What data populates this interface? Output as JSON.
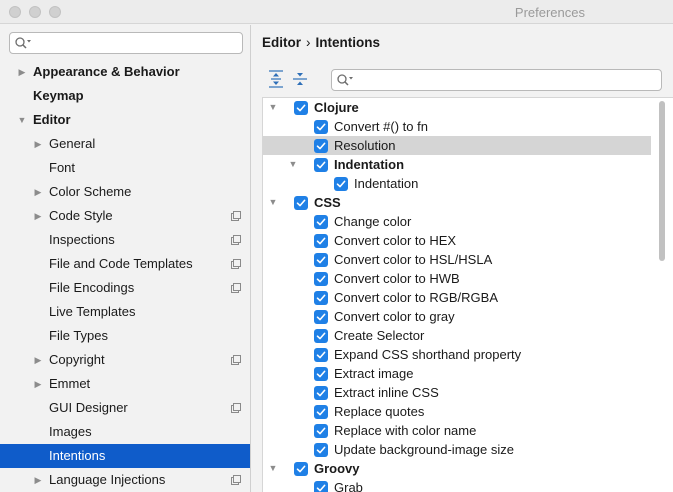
{
  "window": {
    "title": "Preferences"
  },
  "sidebar": {
    "search_placeholder": "",
    "items": [
      {
        "label": "Appearance & Behavior",
        "level": 0,
        "arrow": "right",
        "bold": true,
        "project": false
      },
      {
        "label": "Keymap",
        "level": 0,
        "arrow": "none",
        "bold": true,
        "project": false
      },
      {
        "label": "Editor",
        "level": 0,
        "arrow": "down",
        "bold": true,
        "project": false
      },
      {
        "label": "General",
        "level": 1,
        "arrow": "right",
        "bold": false,
        "project": false
      },
      {
        "label": "Font",
        "level": 1,
        "arrow": "none",
        "bold": false,
        "project": false
      },
      {
        "label": "Color Scheme",
        "level": 1,
        "arrow": "right",
        "bold": false,
        "project": false
      },
      {
        "label": "Code Style",
        "level": 1,
        "arrow": "right",
        "bold": false,
        "project": true
      },
      {
        "label": "Inspections",
        "level": 1,
        "arrow": "none",
        "bold": false,
        "project": true
      },
      {
        "label": "File and Code Templates",
        "level": 1,
        "arrow": "none",
        "bold": false,
        "project": true
      },
      {
        "label": "File Encodings",
        "level": 1,
        "arrow": "none",
        "bold": false,
        "project": true
      },
      {
        "label": "Live Templates",
        "level": 1,
        "arrow": "none",
        "bold": false,
        "project": false
      },
      {
        "label": "File Types",
        "level": 1,
        "arrow": "none",
        "bold": false,
        "project": false
      },
      {
        "label": "Copyright",
        "level": 1,
        "arrow": "right",
        "bold": false,
        "project": true
      },
      {
        "label": "Emmet",
        "level": 1,
        "arrow": "right",
        "bold": false,
        "project": false
      },
      {
        "label": "GUI Designer",
        "level": 1,
        "arrow": "none",
        "bold": false,
        "project": true
      },
      {
        "label": "Images",
        "level": 1,
        "arrow": "none",
        "bold": false,
        "project": false
      },
      {
        "label": "Intentions",
        "level": 1,
        "arrow": "none",
        "bold": false,
        "project": false,
        "selected": true
      },
      {
        "label": "Language Injections",
        "level": 1,
        "arrow": "right",
        "bold": false,
        "project": true
      }
    ]
  },
  "header": {
    "crumb_parent": "Editor",
    "crumb_separator": "›",
    "crumb_current": "Intentions"
  },
  "intentions_search_placeholder": "",
  "tree": [
    {
      "label": "Clojure",
      "level": 0,
      "group": true,
      "arrow": "down",
      "checked": true
    },
    {
      "label": "Convert #() to fn",
      "level": 1,
      "group": false,
      "arrow": "none",
      "checked": true
    },
    {
      "label": "Resolution",
      "level": 1,
      "group": false,
      "arrow": "none",
      "checked": true,
      "highlight": true
    },
    {
      "label": "Indentation",
      "level": 1,
      "group": true,
      "arrow": "down",
      "checked": true
    },
    {
      "label": "Indentation",
      "level": 2,
      "group": false,
      "arrow": "none",
      "checked": true
    },
    {
      "label": "CSS",
      "level": 0,
      "group": true,
      "arrow": "down",
      "checked": true
    },
    {
      "label": "Change color",
      "level": 1,
      "group": false,
      "arrow": "none",
      "checked": true
    },
    {
      "label": "Convert color to HEX",
      "level": 1,
      "group": false,
      "arrow": "none",
      "checked": true
    },
    {
      "label": "Convert color to HSL/HSLA",
      "level": 1,
      "group": false,
      "arrow": "none",
      "checked": true
    },
    {
      "label": "Convert color to HWB",
      "level": 1,
      "group": false,
      "arrow": "none",
      "checked": true
    },
    {
      "label": "Convert color to RGB/RGBA",
      "level": 1,
      "group": false,
      "arrow": "none",
      "checked": true
    },
    {
      "label": "Convert color to gray",
      "level": 1,
      "group": false,
      "arrow": "none",
      "checked": true
    },
    {
      "label": "Create Selector",
      "level": 1,
      "group": false,
      "arrow": "none",
      "checked": true
    },
    {
      "label": "Expand CSS shorthand property",
      "level": 1,
      "group": false,
      "arrow": "none",
      "checked": true
    },
    {
      "label": "Extract image",
      "level": 1,
      "group": false,
      "arrow": "none",
      "checked": true
    },
    {
      "label": "Extract inline CSS",
      "level": 1,
      "group": false,
      "arrow": "none",
      "checked": true
    },
    {
      "label": "Replace quotes",
      "level": 1,
      "group": false,
      "arrow": "none",
      "checked": true
    },
    {
      "label": "Replace with color name",
      "level": 1,
      "group": false,
      "arrow": "none",
      "checked": true
    },
    {
      "label": "Update background-image size",
      "level": 1,
      "group": false,
      "arrow": "none",
      "checked": true
    },
    {
      "label": "Groovy",
      "level": 0,
      "group": true,
      "arrow": "down",
      "checked": true
    },
    {
      "label": "Grab",
      "level": 1,
      "group": false,
      "arrow": "none",
      "checked": true
    }
  ],
  "colors": {
    "accent": "#0f5cca",
    "checkbox": "#1f80e6",
    "row_highlight": "#d5d5d5"
  },
  "icons": {
    "search": "magnifier-dropdown-icon",
    "expand_all": "expand-all-icon",
    "collapse_all": "collapse-all-icon",
    "project_level": "project-settings-icon",
    "tree_arrow_right": "▶",
    "tree_arrow_down": "▼"
  }
}
